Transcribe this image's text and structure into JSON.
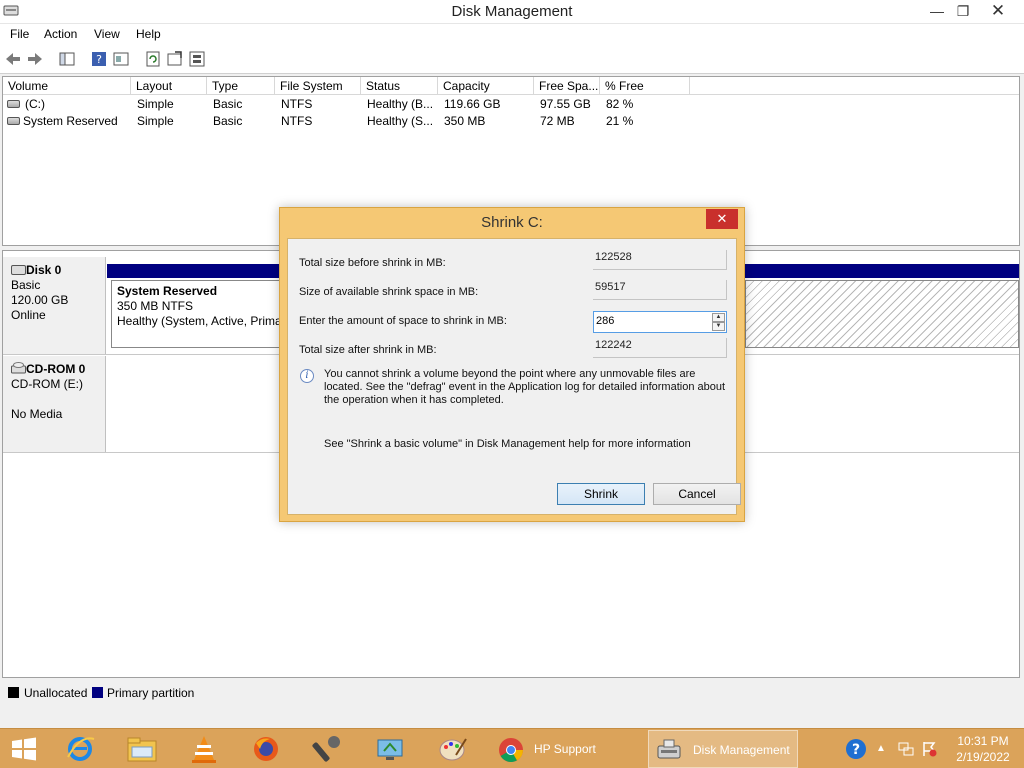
{
  "window": {
    "title": "Disk Management",
    "min_glyph": "—",
    "max_glyph": "❐",
    "close_glyph": "✕"
  },
  "menu": {
    "file": "File",
    "action": "Action",
    "view": "View",
    "help": "Help"
  },
  "toolbar": {
    "icons": [
      "back-arrow-icon",
      "forward-arrow-icon",
      "show-hide-console-tree-icon",
      "help-icon",
      "properties-icon",
      "refresh-icon",
      "export-list-icon",
      "rescan-disks-icon"
    ]
  },
  "volume_list": {
    "columns": [
      "Volume",
      "Layout",
      "Type",
      "File System",
      "Status",
      "Capacity",
      "Free Spa...",
      "% Free"
    ],
    "rows": [
      {
        "volume": "(C:)",
        "layout": "Simple",
        "type": "Basic",
        "fs": "NTFS",
        "status": "Healthy (B...",
        "capacity": "119.66 GB",
        "free": "97.55 GB",
        "pct": "82 %"
      },
      {
        "volume": "System Reserved",
        "layout": "Simple",
        "type": "Basic",
        "fs": "NTFS",
        "status": "Healthy (S...",
        "capacity": "350 MB",
        "free": "72 MB",
        "pct": "21 %"
      }
    ]
  },
  "graph": {
    "disk0": {
      "name": "Disk 0",
      "type": "Basic",
      "size": "120.00 GB",
      "state": "Online"
    },
    "sys_partition": {
      "name": "System Reserved",
      "size": "350 MB NTFS",
      "status": "Healthy (System, Active, Primar"
    },
    "cdrom": {
      "name": "CD-ROM 0",
      "drive": "CD-ROM (E:)",
      "media": "No Media"
    }
  },
  "legend": {
    "unallocated": "Unallocated",
    "primary": "Primary partition",
    "colors": {
      "unallocated": "#000000",
      "primary": "#000080"
    }
  },
  "dialog": {
    "title": "Shrink C:",
    "close_glyph": "✕",
    "total_before_label": "Total size before shrink in MB:",
    "total_before_value": "122528",
    "available_label": "Size of available shrink space in MB:",
    "available_value": "59517",
    "amount_label": "Enter the amount of space to shrink in MB:",
    "amount_value": "286",
    "total_after_label": "Total size after shrink in MB:",
    "total_after_value": "122242",
    "info_text": "You cannot shrink a volume beyond the point where any unmovable files are located. See the \"defrag\" event in the Application log for detailed information about the operation when it has completed.",
    "help_text": "See \"Shrink a basic volume\" in Disk Management help for more information",
    "shrink_label": "Shrink",
    "cancel_label": "Cancel"
  },
  "taskbar": {
    "apps": [
      {
        "name": "HP Support Assist...",
        "active": false
      },
      {
        "name": "Disk Management",
        "active": true
      }
    ],
    "time": "10:31 PM",
    "date": "2/19/2022",
    "accent": "#dba35a"
  }
}
